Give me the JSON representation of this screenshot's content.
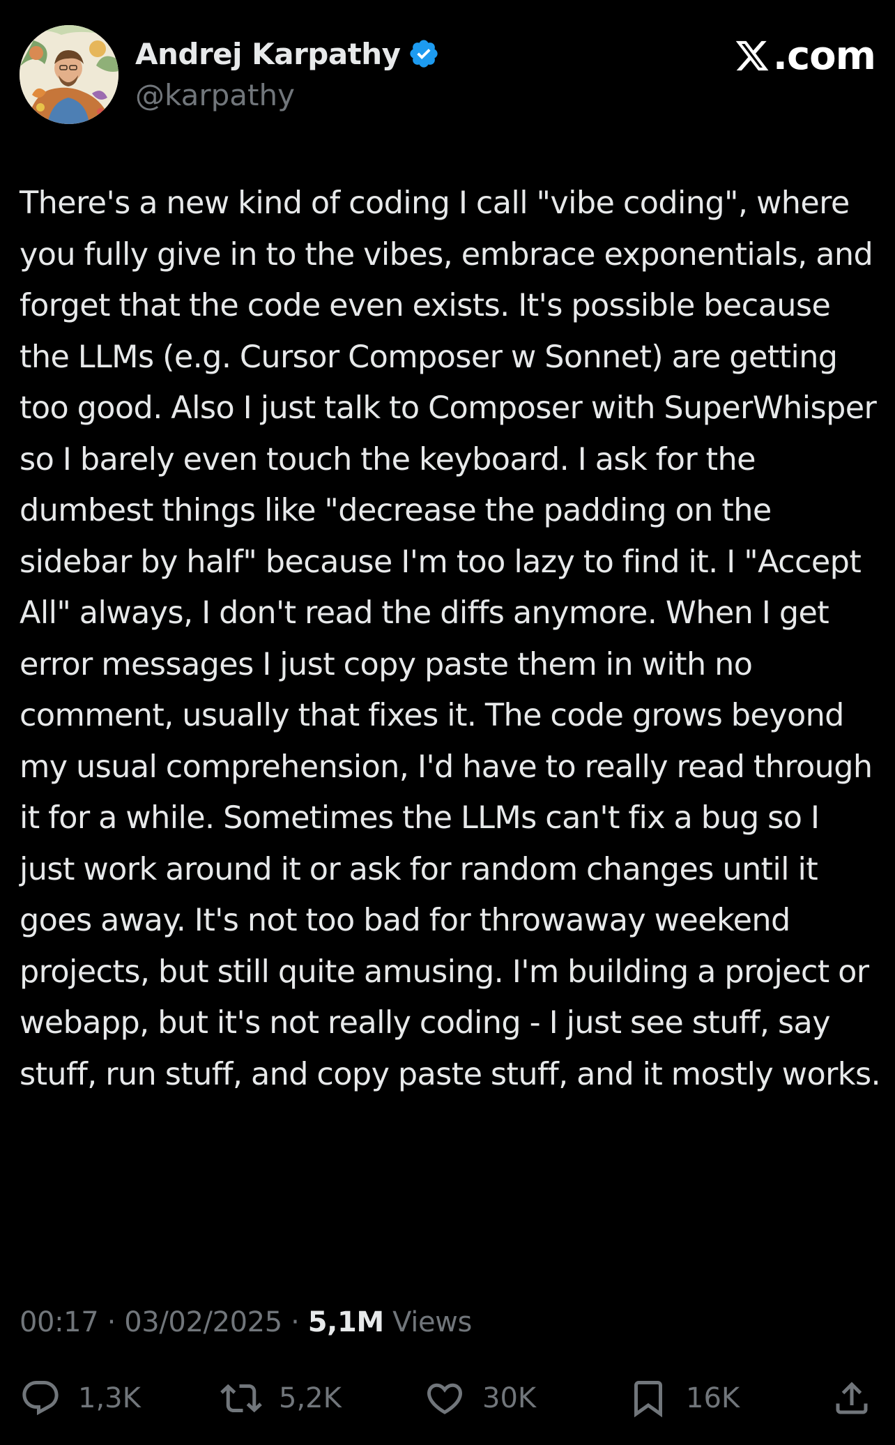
{
  "author": {
    "display_name": "Andrej Karpathy",
    "handle": "@karpathy",
    "verified": true,
    "avatar_icon": "illustrated-portrait-avatar"
  },
  "brand": {
    "label": ".com",
    "logo_icon": "x-logo-icon"
  },
  "tweet": {
    "text": "There's a new kind of coding I call \"vibe coding\", where you fully give in to the vibes, embrace exponentials, and forget that the code even exists. It's possible because the LLMs (e.g. Cursor Composer w Sonnet) are getting too good. Also I just talk to Composer with SuperWhisper so I barely even touch the keyboard. I ask for the dumbest things like \"decrease the padding on the sidebar by half\" because I'm too lazy to find it. I \"Accept All\" always, I don't read the diffs anymore. When I get error messages I just copy paste them in with no comment, usually that fixes it. The code grows beyond my usual comprehension, I'd have to really read through it for a while. Sometimes the LLMs can't fix a bug so I just work around it or ask for random changes until it goes away. It's not too bad for throwaway weekend projects, but still quite amusing. I'm building a project or webapp, but it's not really coding - I just see stuff, say stuff, run stuff, and copy paste stuff, and it mostly works."
  },
  "meta": {
    "time": "00:17",
    "separator": " · ",
    "date": "03/02/2025",
    "views_count": "5,1M",
    "views_label": " Views"
  },
  "actions": {
    "replies": "1,3K",
    "reposts": "5,2K",
    "likes": "30K",
    "bookmarks": "16K"
  },
  "colors": {
    "background": "#000000",
    "primary_text": "#e7e9ea",
    "secondary_text": "#71767b",
    "verified_blue": "#1d9bf0"
  }
}
